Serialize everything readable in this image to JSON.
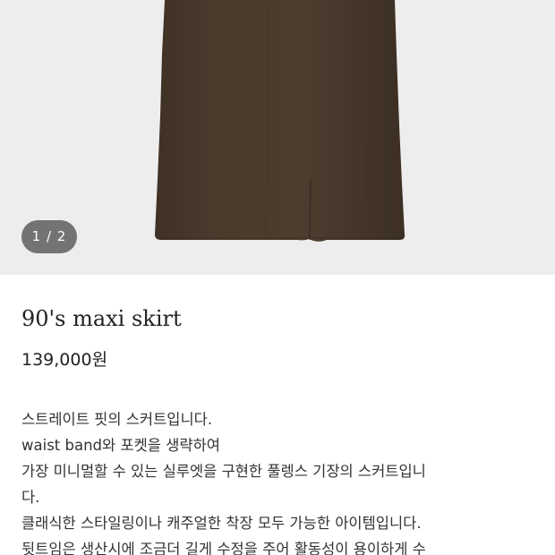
{
  "gallery": {
    "image_name": "skirt-product-image",
    "counter": "1 / 2",
    "current_index": 1,
    "total_images": 2,
    "background_color": "#ededed",
    "product_color": "#4a3a2c"
  },
  "product": {
    "title": "90's maxi skirt",
    "price": "139,000원",
    "description": [
      "스트레이트 핏의 스커트입니다.",
      "waist band와 포켓을 생략하여",
      "가장 미니멀할 수 있는 실루엣을 구현한 풀렝스 기장의 스커트입니",
      "다.",
      "클래식한 스타일링이나 캐주얼한 착장 모두 가능한 아이템입니다.",
      "뒷트임은 생산시에 조금더 길게 수정을 주어 활동성이 용이하게 수"
    ]
  }
}
